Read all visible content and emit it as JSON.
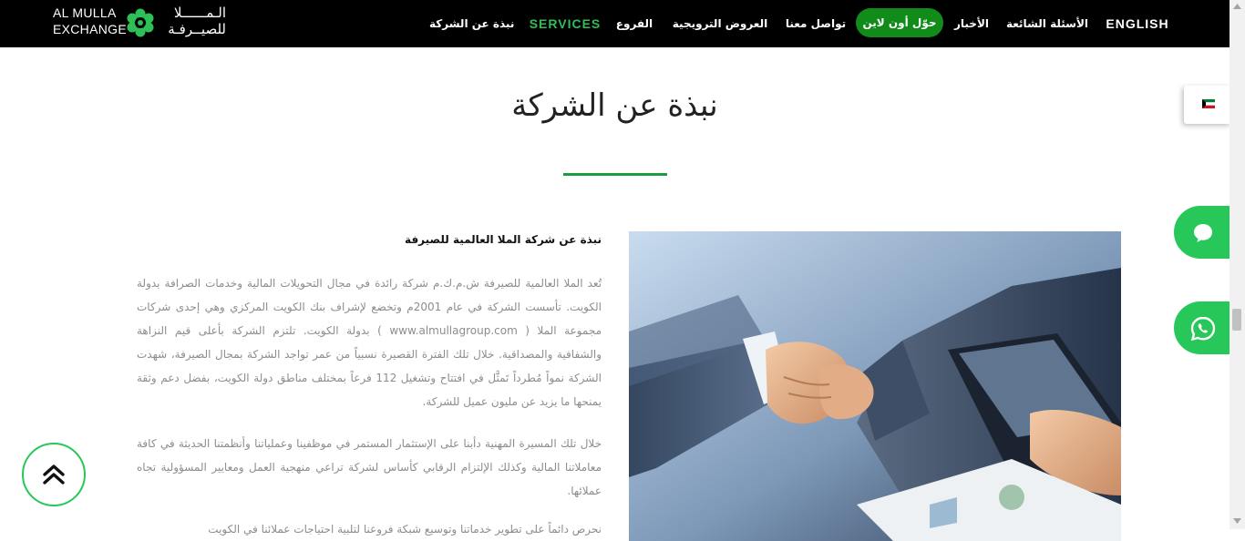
{
  "logo": {
    "en_line1": "AL MULLA",
    "en_line2": "EXCHANGE",
    "ar_line1": "الـمــــــلا",
    "ar_line2": "للصيــرفـة"
  },
  "nav": {
    "english": "ENGLISH",
    "faq": "الأسئلة الشائعة",
    "news": "الأخبار",
    "transfer_online": "حوّل أون لاين",
    "contact": "تواصل معنا",
    "promotions": "العروض الترويجية",
    "branches": "الفروع",
    "services": "SERVICES",
    "about": "نبذة عن الشركة"
  },
  "page": {
    "title": "نبذة عن الشركة",
    "section_heading": "نبذة عن شركة الملا العالمية للصيرفة",
    "paragraph1": "تُعد الملا العالمية للصيرفة ش.م.ك.م شركة رائدة في مجال التحويلات المالية وخدمات الصرافة بدولة الكويت. تأسست الشركة في عام 2001م وتخضع لإشراف بنك الكويت المركزي وهي إحدى شركات مجموعة الملا ( www.almullagroup.com ) بدولة الكويت. تلتزم الشركة بأعلى قيم النزاهة والشفافية والمصداقية. خلال تلك الفترة القصيرة نسبياً من عمر تواجد الشركة بمجال الصيرفة، شهدت الشركة نمواً مُطرداً تَمثَّل في افتتاح وتشغيل 112 فرعاً بمختلف مناطق دولة الكويت، بفضل دعم وثقة يمنحها ما يزيد عن مليون عميل للشركة.",
    "paragraph2": "خلال تلك المسيرة المهنية دأبنا على الإستثمار المستمر في موظفينا وعملياتنا وأنظمتنا الحديثة في كافة معاملاتنا المالية وكذلك الإلتزام الرقابي كأساس لشركة تراعي منهجية العمل ومعايير المسؤولية تجاه عملائها.",
    "paragraph3": "نحرص دائماً على تطوير خدماتنا وتوسيع شبكة فروعنا لتلبية احتياجات عملائنا في الكويت"
  },
  "widgets": {
    "flag_icon": "kuwait-flag-icon",
    "chat_icon": "chat-bubble-icon",
    "whatsapp_icon": "whatsapp-icon",
    "top_icon": "double-chevron-up-icon"
  },
  "colors": {
    "header_bg": "#000000",
    "accent_green": "#27c75a",
    "pill_green": "#118c1a",
    "services_green": "#2ebf57",
    "rule_green": "#1a9e3d"
  }
}
